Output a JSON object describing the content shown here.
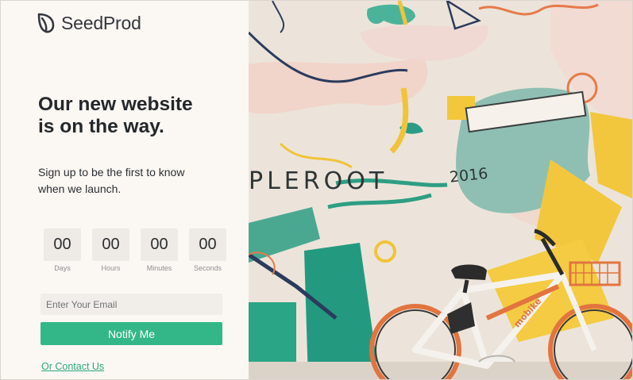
{
  "brand": {
    "name": "SeedProd",
    "color": "#33373d"
  },
  "hero": {
    "headline_line1": "Our new website",
    "headline_line2": "is on the way.",
    "subtext_line1": "Sign up to be the first to know",
    "subtext_line2": "when we launch."
  },
  "countdown": [
    {
      "value": "00",
      "label": "Days"
    },
    {
      "value": "00",
      "label": "Hours"
    },
    {
      "value": "00",
      "label": "Minutes"
    },
    {
      "value": "00",
      "label": "Seconds"
    }
  ],
  "form": {
    "email_placeholder": "Enter Your Email",
    "email_value": "",
    "submit_label": "Notify Me",
    "accent": "#33b789"
  },
  "contact_link": "Or Contact Us",
  "photo": {
    "wall_text": "PLEROOT",
    "wall_year": "2016",
    "bike_brand": "mobike"
  }
}
